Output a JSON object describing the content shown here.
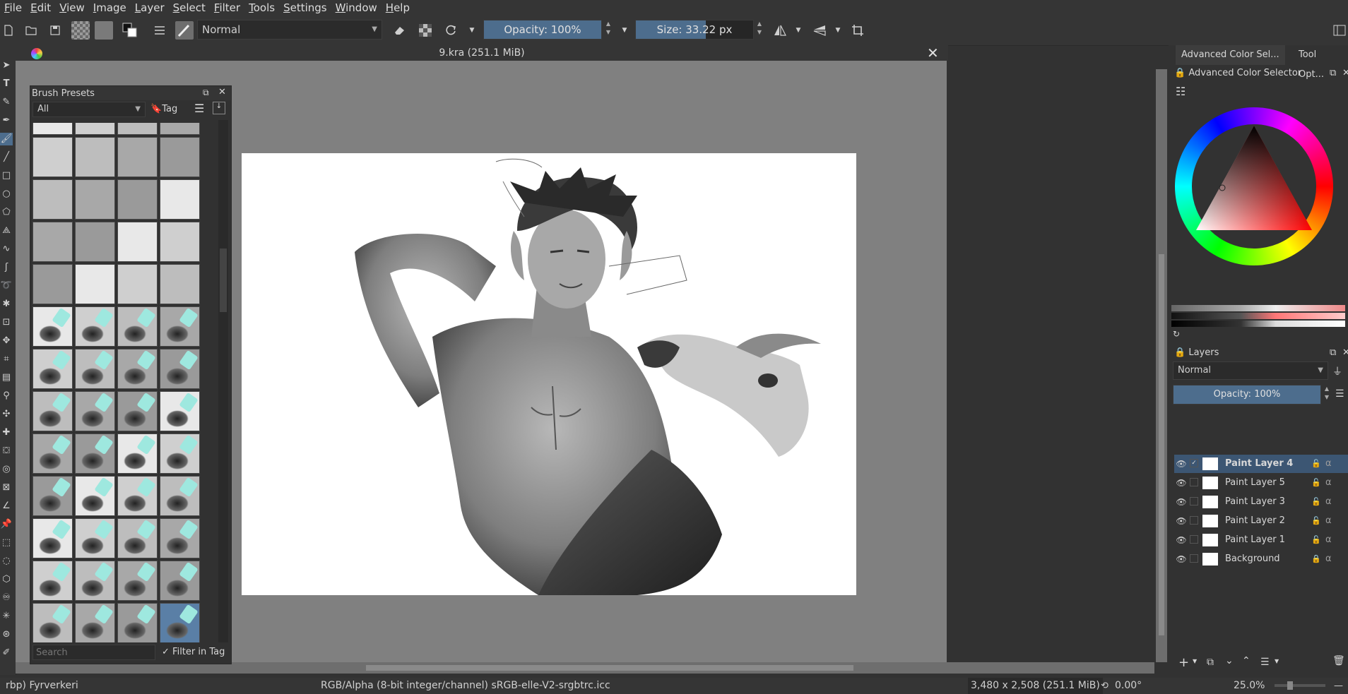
{
  "menu": [
    "File",
    "Edit",
    "View",
    "Image",
    "Layer",
    "Select",
    "Filter",
    "Tools",
    "Settings",
    "Window",
    "Help"
  ],
  "toolbar": {
    "blend_mode": "Normal",
    "opacity_label": "Opacity: 100%",
    "opacity_fraction": 1.0,
    "size_label": "Size: 33.22 px",
    "size_fraction": 0.18
  },
  "document": {
    "title": "9.kra (251.1 MiB)"
  },
  "brush_presets": {
    "title": "Brush Presets",
    "filter": "All",
    "tag_label": "Tag",
    "search_placeholder": "Search",
    "filter_in_tag": "Filter in Tag"
  },
  "right_panel": {
    "tabs": [
      "Advanced Color Sel...",
      "Tool Opt..."
    ],
    "color_selector_title": "Advanced Color Selector",
    "layers_title": "Layers",
    "layers_blend": "Normal",
    "layers_opacity": "Opacity:  100%",
    "layers": [
      {
        "name": "Paint Layer 4",
        "active": true,
        "checked": true
      },
      {
        "name": "Paint Layer 5",
        "active": false,
        "checked": false
      },
      {
        "name": "Paint Layer 3",
        "active": false,
        "checked": false
      },
      {
        "name": "Paint Layer 2",
        "active": false,
        "checked": false
      },
      {
        "name": "Paint Layer 1",
        "active": false,
        "checked": false
      },
      {
        "name": "Background",
        "active": false,
        "checked": false,
        "locked": true
      }
    ]
  },
  "status": {
    "brush": "rbp) Fyrverkeri",
    "color_space": "RGB/Alpha (8-bit integer/channel)  sRGB-elle-V2-srgbtrc.icc",
    "dimensions": "3,480 x 2,508 (251.1 MiB)",
    "rotation": "0.00°",
    "zoom": "25.0%"
  }
}
